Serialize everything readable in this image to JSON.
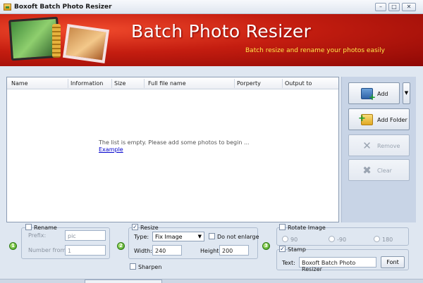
{
  "window": {
    "title": "Boxoft Batch Photo Resizer",
    "min": "–",
    "max": "□",
    "close": "✕"
  },
  "banner": {
    "title": "Batch Photo Resizer",
    "subtitle": "Batch resize and rename your photos easily"
  },
  "file_list": {
    "columns": [
      "Name",
      "Information",
      "Size",
      "Full file name",
      "Porperty",
      "Output to"
    ],
    "empty_message": "The list is empty. Please add some photos to begin ...",
    "example_link": "Example"
  },
  "actions": {
    "add": "Add",
    "add_dropdown": "▼",
    "add_folder": "Add Folder",
    "remove": "Remove",
    "clear": "Clear"
  },
  "rename": {
    "step": "1",
    "label": "Rename",
    "checked": false,
    "prefix_label": "Prefix:",
    "prefix_value": "pic",
    "number_label": "Number from:",
    "number_value": "1"
  },
  "resize": {
    "step": "2",
    "label": "Resize",
    "checked": true,
    "check_mark": "✓",
    "type_label": "Type:",
    "type_value": "Fix Image",
    "type_arrow": "▼",
    "no_enlarge_label": "Do not enlarge",
    "no_enlarge_checked": false,
    "width_label": "Width:",
    "width_value": "240",
    "height_label": "Height:",
    "height_value": "200",
    "sharpen_label": "Sharpen",
    "sharpen_checked": false
  },
  "rotate": {
    "step": "3",
    "label": "Rotate Image",
    "checked": false,
    "options": [
      "90",
      "-90",
      "180"
    ]
  },
  "stamp": {
    "label": "Stamp",
    "checked": true,
    "check_mark": "✓",
    "text_label": "Text:",
    "text_value": "Boxoft Batch Photo Resizer",
    "font_button": "Font"
  }
}
